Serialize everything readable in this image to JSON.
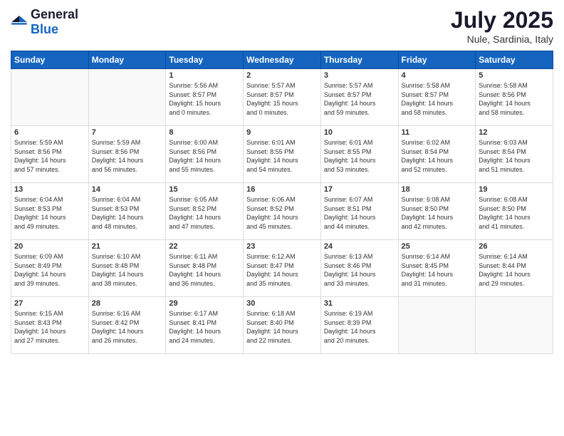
{
  "header": {
    "logo_general": "General",
    "logo_blue": "Blue",
    "title": "July 2025",
    "subtitle": "Nule, Sardinia, Italy"
  },
  "weekdays": [
    "Sunday",
    "Monday",
    "Tuesday",
    "Wednesday",
    "Thursday",
    "Friday",
    "Saturday"
  ],
  "weeks": [
    [
      {
        "day": "",
        "empty": true
      },
      {
        "day": "",
        "empty": true
      },
      {
        "day": "1",
        "sunrise": "5:56 AM",
        "sunset": "8:57 PM",
        "daylight": "15 hours and 0 minutes."
      },
      {
        "day": "2",
        "sunrise": "5:57 AM",
        "sunset": "8:57 PM",
        "daylight": "15 hours and 0 minutes."
      },
      {
        "day": "3",
        "sunrise": "5:57 AM",
        "sunset": "8:57 PM",
        "daylight": "14 hours and 59 minutes."
      },
      {
        "day": "4",
        "sunrise": "5:58 AM",
        "sunset": "8:57 PM",
        "daylight": "14 hours and 58 minutes."
      },
      {
        "day": "5",
        "sunrise": "5:58 AM",
        "sunset": "8:56 PM",
        "daylight": "14 hours and 58 minutes."
      }
    ],
    [
      {
        "day": "6",
        "sunrise": "5:59 AM",
        "sunset": "8:56 PM",
        "daylight": "14 hours and 57 minutes."
      },
      {
        "day": "7",
        "sunrise": "5:59 AM",
        "sunset": "8:56 PM",
        "daylight": "14 hours and 56 minutes."
      },
      {
        "day": "8",
        "sunrise": "6:00 AM",
        "sunset": "8:56 PM",
        "daylight": "14 hours and 55 minutes."
      },
      {
        "day": "9",
        "sunrise": "6:01 AM",
        "sunset": "8:55 PM",
        "daylight": "14 hours and 54 minutes."
      },
      {
        "day": "10",
        "sunrise": "6:01 AM",
        "sunset": "8:55 PM",
        "daylight": "14 hours and 53 minutes."
      },
      {
        "day": "11",
        "sunrise": "6:02 AM",
        "sunset": "8:54 PM",
        "daylight": "14 hours and 52 minutes."
      },
      {
        "day": "12",
        "sunrise": "6:03 AM",
        "sunset": "8:54 PM",
        "daylight": "14 hours and 51 minutes."
      }
    ],
    [
      {
        "day": "13",
        "sunrise": "6:04 AM",
        "sunset": "8:53 PM",
        "daylight": "14 hours and 49 minutes."
      },
      {
        "day": "14",
        "sunrise": "6:04 AM",
        "sunset": "8:53 PM",
        "daylight": "14 hours and 48 minutes."
      },
      {
        "day": "15",
        "sunrise": "6:05 AM",
        "sunset": "8:52 PM",
        "daylight": "14 hours and 47 minutes."
      },
      {
        "day": "16",
        "sunrise": "6:06 AM",
        "sunset": "8:52 PM",
        "daylight": "14 hours and 45 minutes."
      },
      {
        "day": "17",
        "sunrise": "6:07 AM",
        "sunset": "8:51 PM",
        "daylight": "14 hours and 44 minutes."
      },
      {
        "day": "18",
        "sunrise": "6:08 AM",
        "sunset": "8:50 PM",
        "daylight": "14 hours and 42 minutes."
      },
      {
        "day": "19",
        "sunrise": "6:08 AM",
        "sunset": "8:50 PM",
        "daylight": "14 hours and 41 minutes."
      }
    ],
    [
      {
        "day": "20",
        "sunrise": "6:09 AM",
        "sunset": "8:49 PM",
        "daylight": "14 hours and 39 minutes."
      },
      {
        "day": "21",
        "sunrise": "6:10 AM",
        "sunset": "8:48 PM",
        "daylight": "14 hours and 38 minutes."
      },
      {
        "day": "22",
        "sunrise": "6:11 AM",
        "sunset": "8:48 PM",
        "daylight": "14 hours and 36 minutes."
      },
      {
        "day": "23",
        "sunrise": "6:12 AM",
        "sunset": "8:47 PM",
        "daylight": "14 hours and 35 minutes."
      },
      {
        "day": "24",
        "sunrise": "6:13 AM",
        "sunset": "8:46 PM",
        "daylight": "14 hours and 33 minutes."
      },
      {
        "day": "25",
        "sunrise": "6:14 AM",
        "sunset": "8:45 PM",
        "daylight": "14 hours and 31 minutes."
      },
      {
        "day": "26",
        "sunrise": "6:14 AM",
        "sunset": "8:44 PM",
        "daylight": "14 hours and 29 minutes."
      }
    ],
    [
      {
        "day": "27",
        "sunrise": "6:15 AM",
        "sunset": "8:43 PM",
        "daylight": "14 hours and 27 minutes."
      },
      {
        "day": "28",
        "sunrise": "6:16 AM",
        "sunset": "8:42 PM",
        "daylight": "14 hours and 26 minutes."
      },
      {
        "day": "29",
        "sunrise": "6:17 AM",
        "sunset": "8:41 PM",
        "daylight": "14 hours and 24 minutes."
      },
      {
        "day": "30",
        "sunrise": "6:18 AM",
        "sunset": "8:40 PM",
        "daylight": "14 hours and 22 minutes."
      },
      {
        "day": "31",
        "sunrise": "6:19 AM",
        "sunset": "8:39 PM",
        "daylight": "14 hours and 20 minutes."
      },
      {
        "day": "",
        "empty": true
      },
      {
        "day": "",
        "empty": true
      }
    ]
  ],
  "labels": {
    "sunrise_label": "Sunrise:",
    "sunset_label": "Sunset:",
    "daylight_label": "Daylight:"
  }
}
